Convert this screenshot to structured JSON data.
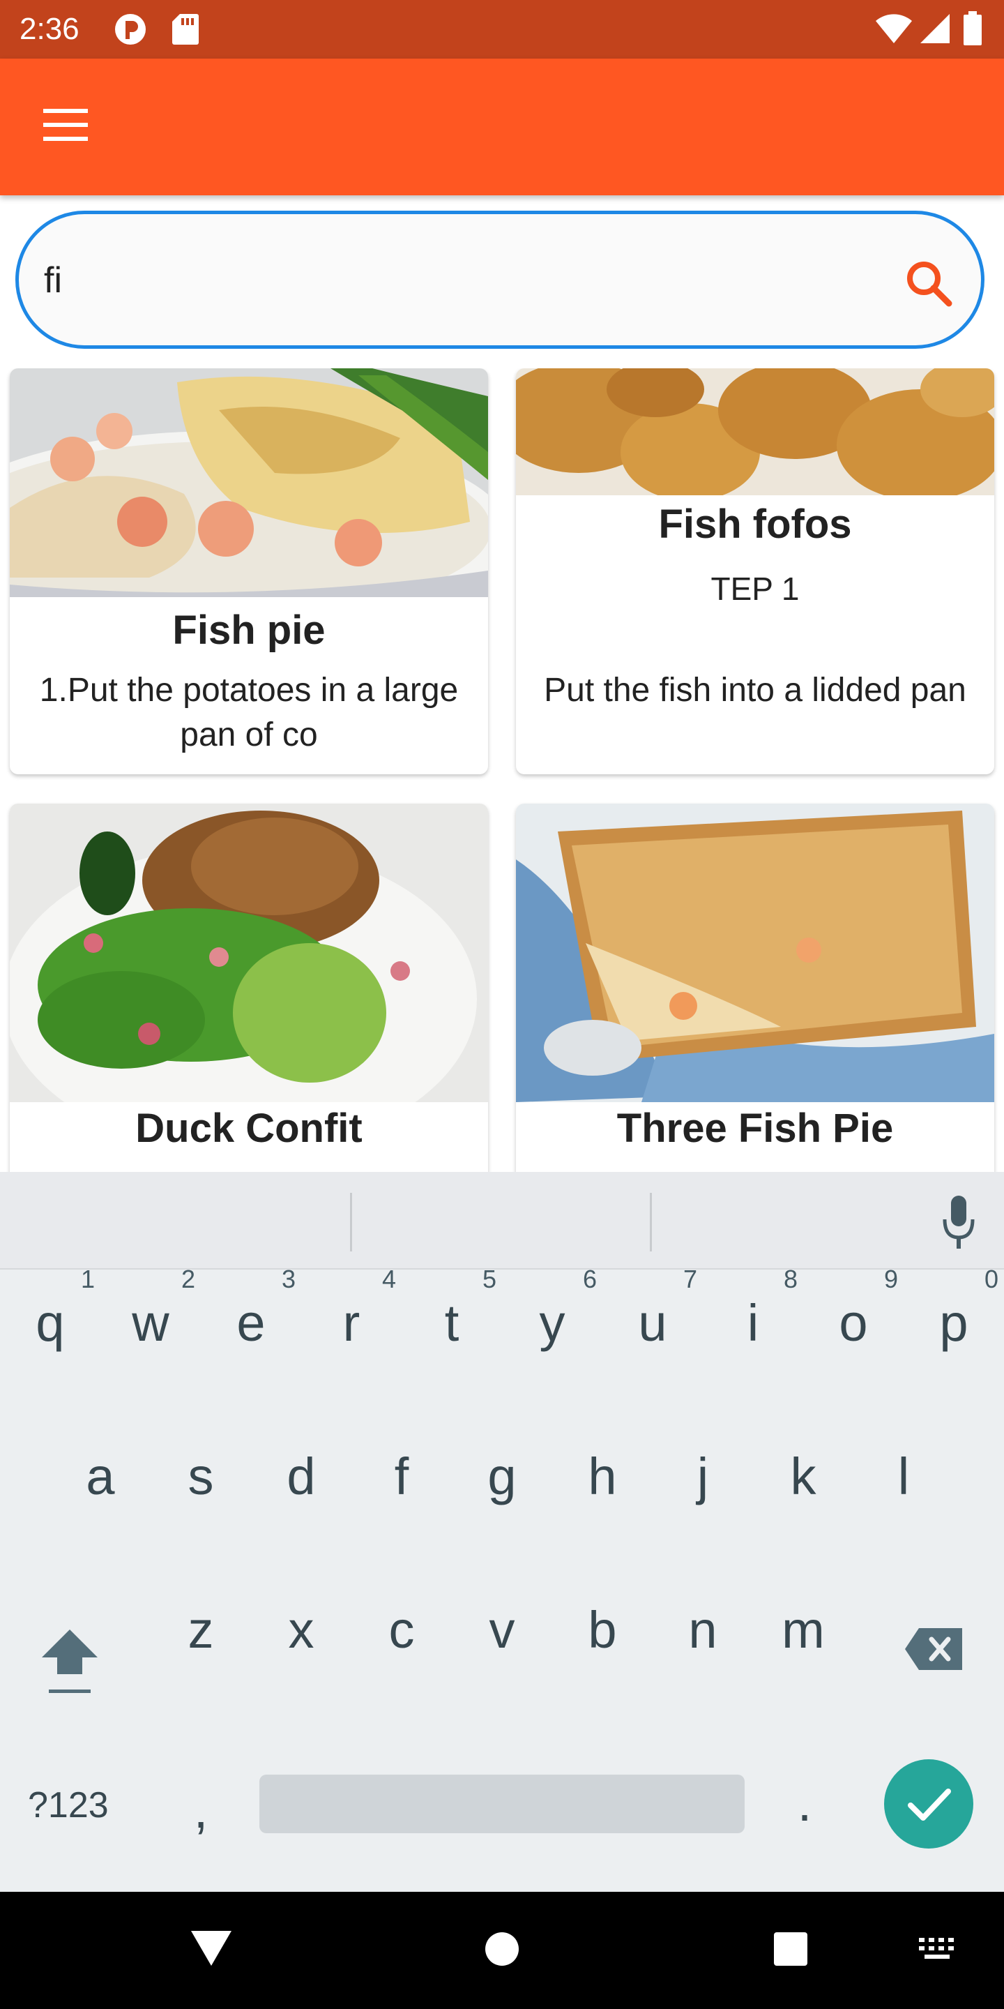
{
  "status_bar": {
    "time": "2:36",
    "icons": [
      "notification-p-icon",
      "sd-card-icon",
      "wifi-icon",
      "signal-icon",
      "battery-icon"
    ]
  },
  "app_bar": {
    "menu_icon": "hamburger-menu-icon",
    "color": "#ff5722"
  },
  "search": {
    "value": "fi",
    "placeholder": "",
    "icon": "search-icon",
    "border_color": "#1e88e5",
    "icon_color": "#f4511e"
  },
  "recipes": [
    {
      "title": "Fish pie",
      "description": "1.Put the potatoes in a large pan of co",
      "image": "fish-pie-photo"
    },
    {
      "title": "Fish fofos",
      "description_line1": "TEP 1",
      "description": "Put the fish into a lidded pan",
      "image": "fish-fofos-photo"
    },
    {
      "title": "Duck Confit",
      "image": "duck-confit-photo"
    },
    {
      "title": "Three Fish Pie",
      "image": "three-fish-pie-photo"
    }
  ],
  "keyboard": {
    "row1": [
      {
        "key": "q",
        "hint": "1"
      },
      {
        "key": "w",
        "hint": "2"
      },
      {
        "key": "e",
        "hint": "3"
      },
      {
        "key": "r",
        "hint": "4"
      },
      {
        "key": "t",
        "hint": "5"
      },
      {
        "key": "y",
        "hint": "6"
      },
      {
        "key": "u",
        "hint": "7"
      },
      {
        "key": "i",
        "hint": "8"
      },
      {
        "key": "o",
        "hint": "9"
      },
      {
        "key": "p",
        "hint": "0"
      }
    ],
    "row2": [
      "a",
      "s",
      "d",
      "f",
      "g",
      "h",
      "j",
      "k",
      "l"
    ],
    "row3": [
      "z",
      "x",
      "c",
      "v",
      "b",
      "n",
      "m"
    ],
    "symbols_label": "?123",
    "comma": ",",
    "period": ".",
    "enter_color": "#26a69a"
  },
  "nav_bar": {
    "icons": [
      "back-triangle-icon",
      "home-circle-icon",
      "recents-square-icon",
      "keyboard-switch-icon"
    ]
  }
}
